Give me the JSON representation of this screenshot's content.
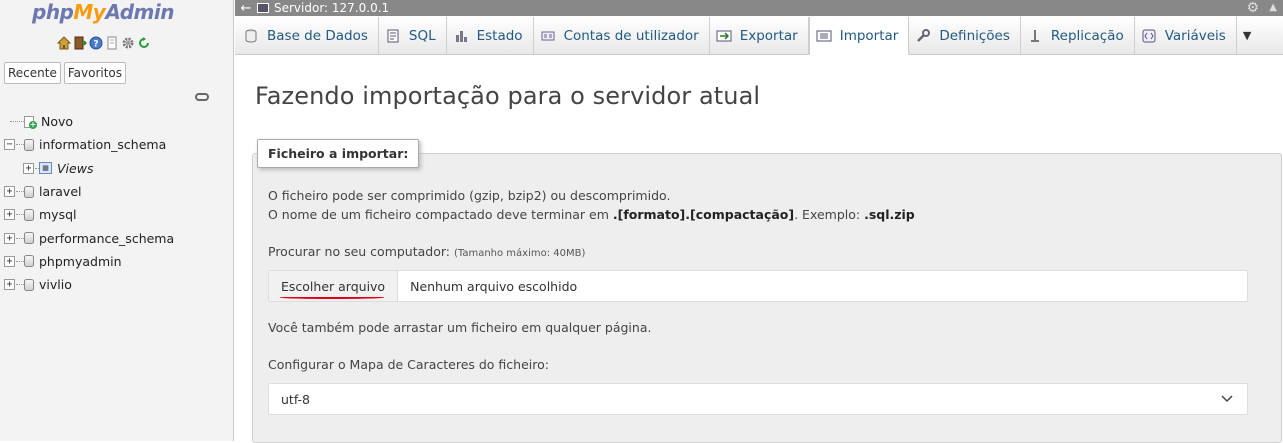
{
  "logo": {
    "php": "php",
    "my": "My",
    "admin": "Admin"
  },
  "quick_icons": [
    "home-icon",
    "exit-icon",
    "docs-icon",
    "docs2-icon",
    "settings-icon",
    "reload-icon"
  ],
  "left_tabs": {
    "recent": "Recente",
    "favorites": "Favoritos"
  },
  "tree": [
    {
      "label": "Novo",
      "type": "new",
      "indent": 0
    },
    {
      "label": "information_schema",
      "type": "db",
      "expanded": true,
      "indent": 0
    },
    {
      "label": "Views",
      "type": "views",
      "indent": 1,
      "italic": true
    },
    {
      "label": "laravel",
      "type": "db",
      "indent": 0
    },
    {
      "label": "mysql",
      "type": "db",
      "indent": 0
    },
    {
      "label": "performance_schema",
      "type": "db",
      "indent": 0
    },
    {
      "label": "phpmyadmin",
      "type": "db",
      "indent": 0
    },
    {
      "label": "vivlio",
      "type": "db",
      "indent": 0
    }
  ],
  "topbar": {
    "server": "Servidor: 127.0.0.1"
  },
  "menu": [
    {
      "label": "Base de Dados",
      "icon": "database-icon"
    },
    {
      "label": "SQL",
      "icon": "sql-icon"
    },
    {
      "label": "Estado",
      "icon": "status-icon"
    },
    {
      "label": "Contas de utilizador",
      "icon": "users-icon"
    },
    {
      "label": "Exportar",
      "icon": "export-icon"
    },
    {
      "label": "Importar",
      "icon": "import-icon",
      "active": true
    },
    {
      "label": "Definições",
      "icon": "wrench-icon"
    },
    {
      "label": "Replicação",
      "icon": "replication-icon"
    },
    {
      "label": "Variáveis",
      "icon": "variables-icon"
    }
  ],
  "main": {
    "title": "Fazendo importação para o servidor atual",
    "legend": "Ficheiro a importar:",
    "line1": "O ficheiro pode ser comprimido (gzip, bzip2) ou descomprimido.",
    "line2_prefix": "O nome de um ficheiro compactado deve terminar em ",
    "line2_bold": ".[formato].[compactação]",
    "line2_mid": ". Exemplo: ",
    "line2_example": ".sql.zip",
    "browse_label": "Procurar no seu computador: ",
    "max_size": "(Tamanho máximo: 40MB)",
    "choose_file": "Escolher arquivo",
    "no_file": "Nenhum arquivo escolhido",
    "drag_text": "Você também pode arrastar um ficheiro em qualquer página.",
    "charset_label": "Configurar o Mapa de Caracteres do ficheiro:",
    "charset_value": "utf-8"
  }
}
